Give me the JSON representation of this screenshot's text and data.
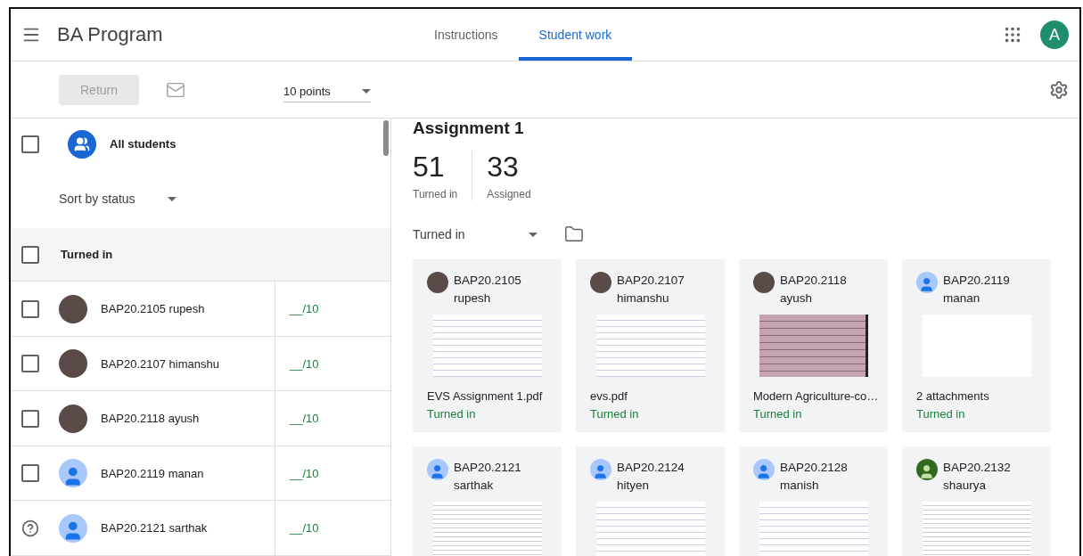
{
  "header": {
    "title": "BA Program",
    "tabs": [
      {
        "label": "Instructions",
        "selected": false
      },
      {
        "label": "Student work",
        "selected": true
      }
    ],
    "account_initial": "A"
  },
  "toolbar": {
    "return_button": {
      "label": "Return",
      "disabled": true
    },
    "points": "10 points"
  },
  "roster": {
    "all_students": {
      "label": "All students",
      "checked": false
    },
    "sort": "Sort by status",
    "group": {
      "label": "Turned in",
      "checked": false
    },
    "students": [
      {
        "name": "BAP20.2105 rupesh",
        "avatar": {
          "kind": "photo"
        },
        "grade": "__/10",
        "checked": false
      },
      {
        "name": "BAP20.2107 himanshu",
        "avatar": {
          "kind": "photo"
        },
        "grade": "__/10",
        "checked": false
      },
      {
        "name": "BAP20.2118 ayush",
        "avatar": {
          "kind": "photo"
        },
        "grade": "__/10",
        "checked": false
      },
      {
        "name": "BAP20.2119 manan",
        "avatar": {
          "kind": "default"
        },
        "grade": "__/10",
        "checked": false
      },
      {
        "name": "BAP20.2121 sarthak",
        "avatar": {
          "kind": "default"
        },
        "grade": "__/10"
      }
    ]
  },
  "assignment": {
    "title": "Assignment 1",
    "stats": [
      {
        "value": "51",
        "label": "Turned in"
      },
      {
        "value": "33",
        "label": "Assigned"
      }
    ],
    "filter": "Turned in",
    "cards": [
      {
        "id_line": "BAP20.2105",
        "name": "rupesh",
        "avatar": {
          "kind": "photo"
        },
        "thumbnail": {
          "kind": "lined"
        },
        "file": "EVS Assignment 1.pdf",
        "status": "Turned in"
      },
      {
        "id_line": "BAP20.2107",
        "name": "himanshu",
        "avatar": {
          "kind": "photo"
        },
        "thumbnail": {
          "kind": "lined"
        },
        "file": "evs.pdf",
        "status": "Turned in"
      },
      {
        "id_line": "BAP20.2118",
        "name": "ayush",
        "avatar": {
          "kind": "photo"
        },
        "thumbnail": {
          "kind": "photo"
        },
        "file": "Modern Agriculture-co…",
        "status": "Turned in"
      },
      {
        "id_line": "BAP20.2119",
        "name": "manan",
        "avatar": {
          "kind": "default"
        },
        "thumbnail": {
          "kind": "blank"
        },
        "file": "2 attachments",
        "status": "Turned in"
      },
      {
        "id_line": "BAP20.2121",
        "name": "sarthak",
        "avatar": {
          "kind": "default"
        },
        "thumbnail": {
          "kind": "typed"
        }
      },
      {
        "id_line": "BAP20.2124",
        "name": "hityen",
        "avatar": {
          "kind": "default"
        },
        "thumbnail": {
          "kind": "lined"
        }
      },
      {
        "id_line": "BAP20.2128",
        "name": "manish",
        "avatar": {
          "kind": "default"
        },
        "thumbnail": {
          "kind": "lined"
        }
      },
      {
        "id_line": "BAP20.2132",
        "name": "shaurya",
        "avatar": {
          "kind": "icon"
        },
        "thumbnail": {
          "kind": "typed"
        }
      }
    ]
  }
}
